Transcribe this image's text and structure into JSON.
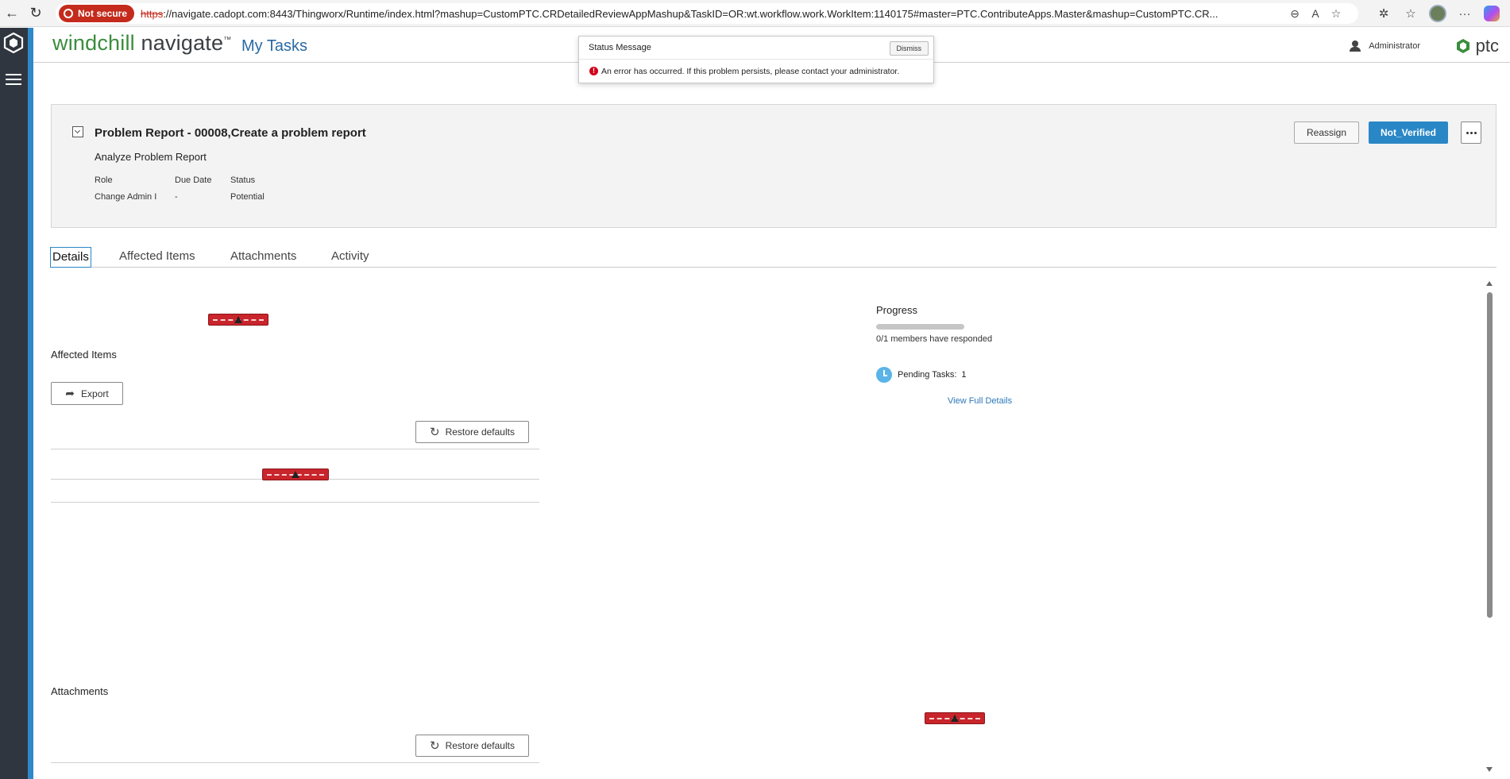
{
  "browser": {
    "security_label": "Not secure",
    "url_scheme": "https",
    "url_rest": "://navigate.cadopt.com:8443/Thingworx/Runtime/index.html?mashup=CustomPTC.CRDetailedReviewAppMashup&TaskID=OR:wt.workflow.work.WorkItem:1140175#master=PTC.ContributeApps.Master&mashup=CustomPTC.CR..."
  },
  "header": {
    "brand_primary": "windchill",
    "brand_secondary": "navigate",
    "brand_tm": "™",
    "page_title": "My Tasks",
    "user_name": "Administrator",
    "vendor_logo": "ptc"
  },
  "status_message": {
    "title": "Status Message",
    "dismiss_label": "Dismiss",
    "text": "An error has occurred. If this problem persists, please contact your administrator."
  },
  "task": {
    "title": "Problem Report - 00008,Create a problem report",
    "subtitle": "Analyze Problem Report",
    "columns": {
      "role": "Role",
      "due_date": "Due Date",
      "status": "Status"
    },
    "values": {
      "role": "Change Admin I",
      "due_date": "-",
      "status": "Potential"
    },
    "actions": {
      "reassign": "Reassign",
      "primary": "Not_Verified"
    }
  },
  "tabs": [
    {
      "label": "Details",
      "active": true
    },
    {
      "label": "Affected Items",
      "active": false
    },
    {
      "label": "Attachments",
      "active": false
    },
    {
      "label": "Activity",
      "active": false
    }
  ],
  "details": {
    "affected_items_heading": "Affected Items",
    "export_label": "Export",
    "restore_label": "Restore defaults",
    "attachments_heading": "Attachments"
  },
  "progress": {
    "heading": "Progress",
    "fraction": 0,
    "responded_text": "0/1 members have responded",
    "pending_label": "Pending Tasks:",
    "pending_count": "1",
    "view_link": "View Full Details"
  },
  "colors": {
    "accent_blue": "#2a87c6",
    "brand_green": "#3a8d3d",
    "error_red": "#c9252c"
  }
}
